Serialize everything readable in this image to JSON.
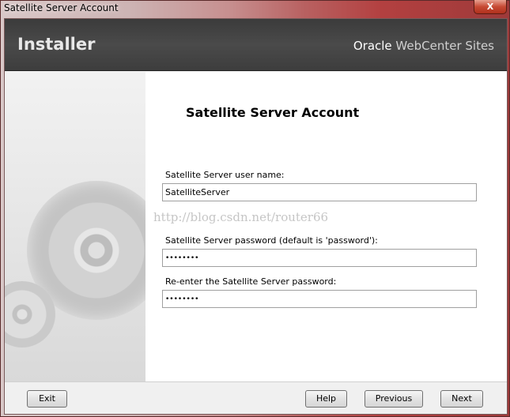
{
  "window": {
    "title": "Satellite Server Account",
    "close_label": "X"
  },
  "header": {
    "app_name": "Installer",
    "brand_oracle": "Oracle",
    "brand_product": " WebCenter Sites"
  },
  "form": {
    "title": "Satellite Server Account",
    "username_label": "Satellite Server user name:",
    "username_value": "SatelliteServer",
    "password_label": "Satellite Server password (default is 'password'):",
    "password_value": "••••••••",
    "confirm_label": "Re-enter the Satellite Server password:",
    "confirm_value": "••••••••"
  },
  "watermark": "http://blog.csdn.net/router66",
  "footer": {
    "exit_label": "Exit",
    "help_label": "Help",
    "previous_label": "Previous",
    "next_label": "Next"
  }
}
